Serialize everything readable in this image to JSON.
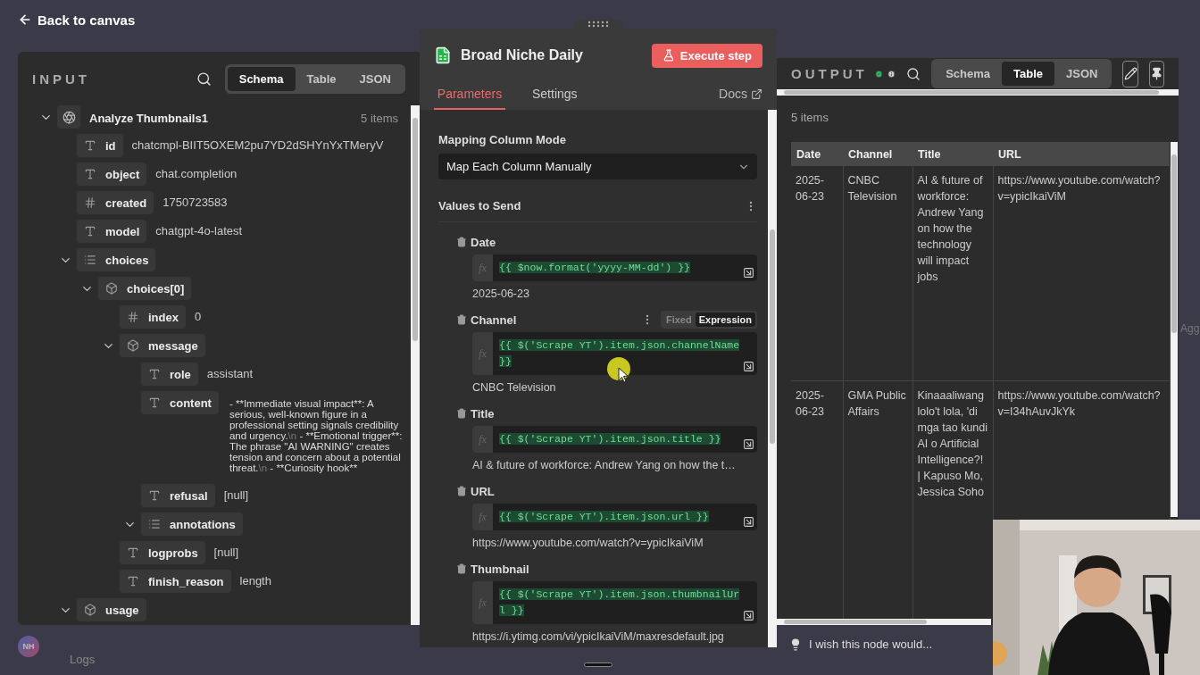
{
  "back_link": "Back to canvas",
  "input": {
    "title": "INPUT",
    "views": [
      {
        "label": "Schema",
        "selected": true
      },
      {
        "label": "Table",
        "selected": false
      },
      {
        "label": "JSON",
        "selected": false
      }
    ],
    "tree": {
      "title": "Analyze Thumbnails1",
      "count": "5 items",
      "expanded": true,
      "children": [
        {
          "key": "id",
          "kind": "string",
          "value": "chatcmpl-BIIT5OXEM2pu7YD2dSHYnYxTMeryV"
        },
        {
          "key": "object",
          "kind": "string",
          "value": "chat.completion"
        },
        {
          "key": "created",
          "kind": "number",
          "value": "1750723583"
        },
        {
          "key": "model",
          "kind": "string",
          "value": "chatgpt-4o-latest"
        },
        {
          "key": "choices",
          "kind": "array",
          "expanded": true,
          "children": [
            {
              "key": "choices[0]",
              "kind": "object",
              "expanded": true,
              "children": [
                {
                  "key": "index",
                  "kind": "number",
                  "value": "0"
                },
                {
                  "key": "message",
                  "kind": "object",
                  "expanded": true,
                  "children": [
                    {
                      "key": "role",
                      "kind": "string",
                      "value": "assistant"
                    },
                    {
                      "key": "content",
                      "kind": "string",
                      "value_parts": [
                        {
                          "kind": "text",
                          "text": "- **Immediate visual impact**: A serious, well-known figure in a professional setting signals credibility and urgency."
                        },
                        {
                          "kind": "escape",
                          "text": "\\n"
                        },
                        {
                          "kind": "text",
                          "text": " - **Emotional trigger**: The phrase \"AI WARNING\" creates tension and concern about a potential threat."
                        },
                        {
                          "kind": "escape",
                          "text": "\\n"
                        },
                        {
                          "kind": "text",
                          "text": " - **Curiosity hook**"
                        }
                      ]
                    },
                    {
                      "key": "refusal",
                      "kind": "string",
                      "value": "[null]"
                    },
                    {
                      "key": "annotations",
                      "kind": "array",
                      "expanded": true
                    }
                  ]
                },
                {
                  "key": "logprobs",
                  "kind": "string",
                  "value": "[null]"
                },
                {
                  "key": "finish_reason",
                  "kind": "string",
                  "value": "length"
                }
              ]
            }
          ]
        },
        {
          "key": "usage",
          "kind": "object",
          "expanded": true
        }
      ]
    }
  },
  "node": {
    "title": "Broad Niche Daily",
    "action": "Execute step",
    "tabs": [
      {
        "label": "Parameters",
        "selected": true
      },
      {
        "label": "Settings",
        "selected": false
      }
    ],
    "docs": "Docs",
    "mapping": {
      "label": "Mapping Column Mode",
      "value": "Map Each Column Manually"
    },
    "values_title": "Values to Send",
    "fields": [
      {
        "label": "Date",
        "prefix": "fx",
        "expression": "{{ $now.format('yyyy-MM-dd') }}",
        "result": "2025-06-23"
      },
      {
        "label": "Channel",
        "modes": [
          {
            "label": "Fixed",
            "selected": false
          },
          {
            "label": "Expression",
            "selected": true
          }
        ],
        "prefix": "fx",
        "expression": "{{ $('Scrape YT').item.json.channelName }}",
        "result": "CNBC Television"
      },
      {
        "label": "Title",
        "prefix": "fx",
        "expression": "{{ $('Scrape YT').item.json.title }}",
        "result": "AI & future of workforce: Andrew Yang on how the t…"
      },
      {
        "label": "URL",
        "prefix": "fx",
        "expression": "{{ $('Scrape YT').item.json.url }}",
        "result": "https://www.youtube.com/watch?v=ypicIkaiViM"
      },
      {
        "label": "Thumbnail",
        "prefix": "fx",
        "expression": "{{ $('Scrape YT').item.json.thumbnailUrl }}",
        "result": "https://i.ytimg.com/vi/ypicIkaiViM/maxresdefault.jpg"
      }
    ]
  },
  "output": {
    "title": "OUTPUT",
    "views": [
      {
        "label": "Schema",
        "selected": false
      },
      {
        "label": "Table",
        "selected": true
      },
      {
        "label": "JSON",
        "selected": false
      }
    ],
    "count": "5 items",
    "table": {
      "columns": [
        "Date",
        "Channel",
        "Title",
        "URL"
      ],
      "rows": [
        [
          "2025-06-23",
          "CNBC Television",
          "AI & future of workforce: Andrew Yang on how the technology will impact jobs",
          "https://www.youtube.com/watch?v=ypicIkaiViM"
        ],
        [
          "2025-06-23",
          "GMA Public Affairs",
          "Kinaaaliwang lolo't lola, 'di mga tao kundi AI o Artificial Intelligence?! | Kapuso Mo, Jessica Soho",
          "https://www.youtube.com/watch?v=I34hAuvJkYk"
        ]
      ]
    },
    "feedback": "I wish this node would..."
  },
  "footer": {
    "avatar": "NH",
    "logs": "Logs"
  },
  "canvas_edge_label": "Agg"
}
